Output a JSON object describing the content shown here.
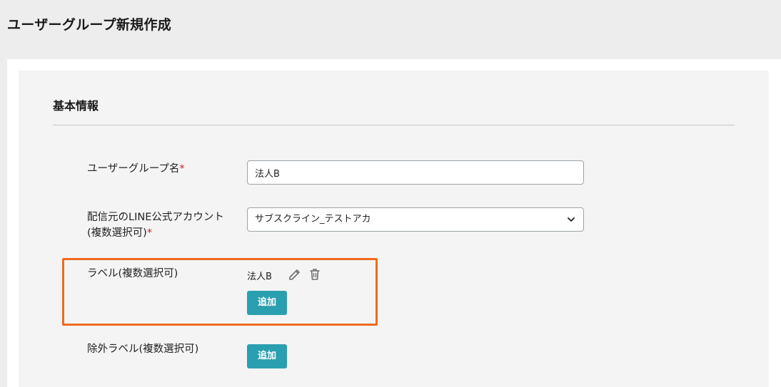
{
  "page": {
    "title": "ユーザーグループ新規作成"
  },
  "section": {
    "title": "基本情報"
  },
  "fields": {
    "group_name": {
      "label": "ユーザーグループ名",
      "required_mark": "*",
      "value": "法人B"
    },
    "line_account": {
      "label_line1": "配信元のLINE公式アカウント",
      "label_line2": "(複数選択可)",
      "required_mark": "*",
      "selected": "サブスクライン_テストアカ"
    },
    "labels": {
      "label": "ラベル(複数選択可)",
      "items": [
        {
          "name": "法人B"
        }
      ],
      "add_label": "追加"
    },
    "exclude_labels": {
      "label": "除外ラベル(複数選択可)",
      "add_label": "追加"
    }
  },
  "icons": {
    "edit": "pencil-icon",
    "delete": "trash-icon",
    "dropdown": "chevron-down-icon"
  },
  "colors": {
    "accent": "#2a9fb0",
    "required": "#c0222c",
    "highlight": "#ef6a1f"
  }
}
